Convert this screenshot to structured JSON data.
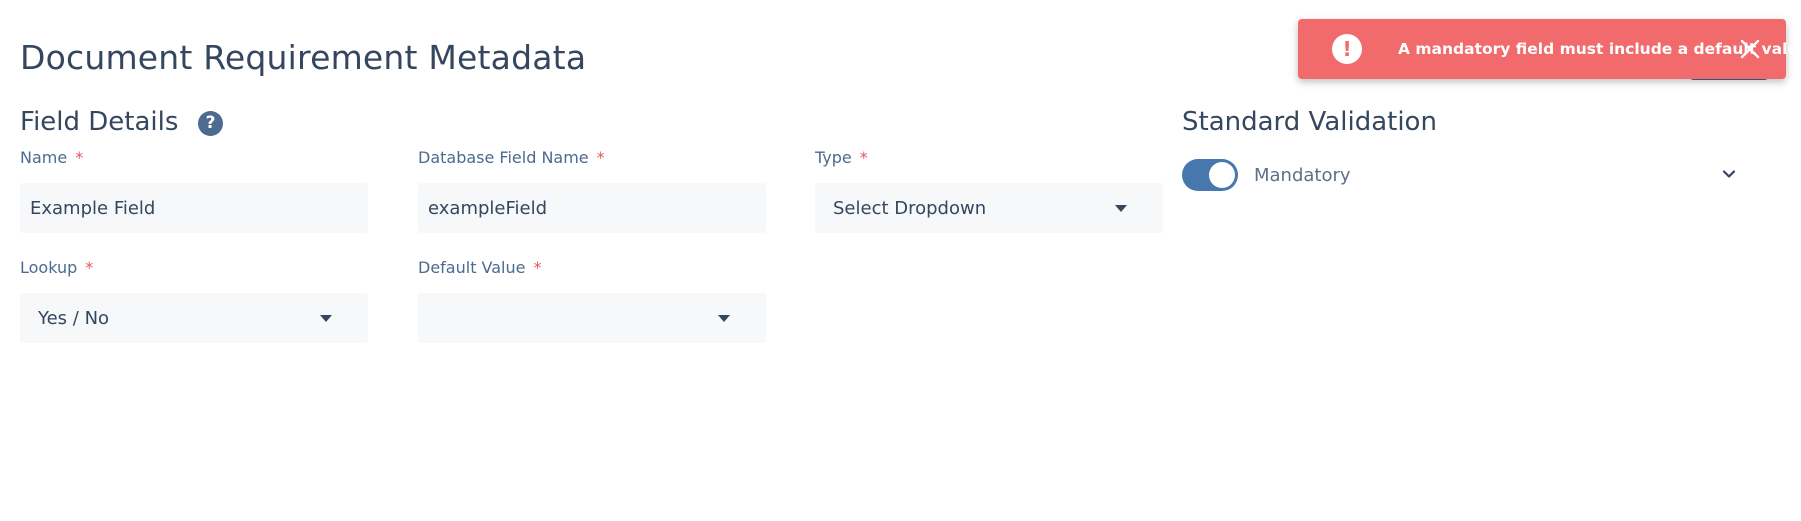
{
  "page": {
    "title": "Document Requirement Metadata"
  },
  "field_details": {
    "heading": "Field Details",
    "help_icon": "question-circle-icon",
    "help_glyph": "?",
    "fields": [
      {
        "label": "Name",
        "required_mark": "*",
        "value": "Example Field",
        "kind": "text"
      },
      {
        "label": "Database Field Name",
        "required_mark": "*",
        "value": "exampleField",
        "kind": "text"
      },
      {
        "label": "Type",
        "required_mark": "*",
        "value": "Select Dropdown",
        "kind": "select"
      },
      {
        "label": "Lookup",
        "required_mark": "*",
        "value": "Yes / No",
        "kind": "select"
      },
      {
        "label": "Default Value",
        "required_mark": "*",
        "value": "",
        "kind": "select"
      }
    ]
  },
  "standard_validation": {
    "heading": "Standard Validation",
    "mandatory_label": "Mandatory",
    "mandatory_on": true,
    "expand_icon": "chevron-down-icon"
  },
  "toast": {
    "message": "A mandatory field must include a default value.",
    "icon": "exclamation-circle-icon",
    "icon_glyph": "!",
    "close_icon": "close-icon"
  },
  "colors": {
    "accent": "#4677ad",
    "toast_bg": "#f16a6c",
    "required": "#e9545b",
    "label": "#4d6a8f",
    "heading": "#34475f",
    "input_bg": "#f6f8fa"
  }
}
